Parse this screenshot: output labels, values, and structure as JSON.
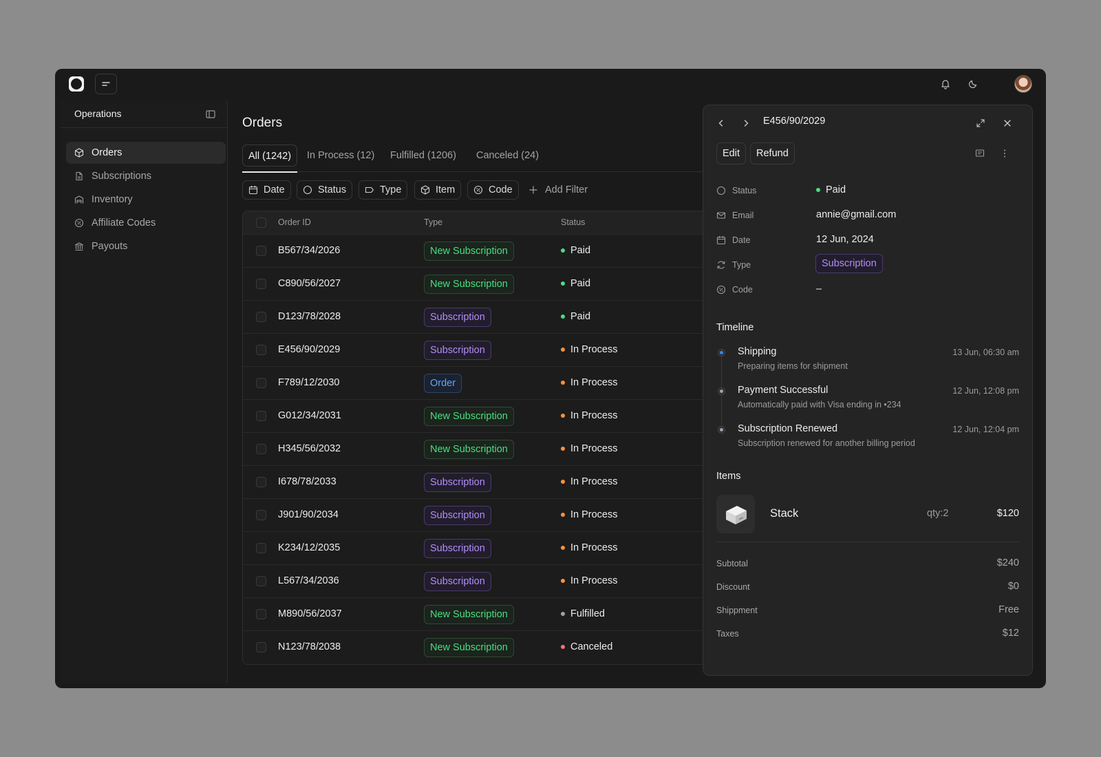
{
  "topbar": {
    "icons": [
      "logo-icon",
      "menu-icon",
      "bell-icon",
      "moon-icon",
      "avatar"
    ]
  },
  "sidebar": {
    "title": "Operations",
    "items": [
      {
        "label": "Orders",
        "icon": "box-icon",
        "active": true
      },
      {
        "label": "Subscriptions",
        "icon": "document-icon",
        "active": false
      },
      {
        "label": "Inventory",
        "icon": "warehouse-icon",
        "active": false
      },
      {
        "label": "Affiliate Codes",
        "icon": "badge-icon",
        "active": false
      },
      {
        "label": "Payouts",
        "icon": "bank-icon",
        "active": false
      }
    ]
  },
  "main": {
    "title": "Orders",
    "tabs": [
      {
        "label": "All (1242)",
        "active": true
      },
      {
        "label": "In Process (12)",
        "active": false
      },
      {
        "label": "Fulfilled (1206)",
        "active": false
      },
      {
        "label": "Canceled (24)",
        "active": false
      }
    ],
    "filters": [
      {
        "label": "Date",
        "icon": "calendar-icon"
      },
      {
        "label": "Status",
        "icon": "circle-icon"
      },
      {
        "label": "Type",
        "icon": "tag-icon"
      },
      {
        "label": "Item",
        "icon": "box-icon"
      },
      {
        "label": "Code",
        "icon": "badge-icon"
      }
    ],
    "add_filter": "Add Filter",
    "columns": [
      "Order ID",
      "Type",
      "Status"
    ],
    "rows": [
      {
        "id": "B567/34/2026",
        "type": "New Subscription",
        "status": "Paid"
      },
      {
        "id": "C890/56/2027",
        "type": "New Subscription",
        "status": "Paid"
      },
      {
        "id": "D123/78/2028",
        "type": "Subscription",
        "status": "Paid"
      },
      {
        "id": "E456/90/2029",
        "type": "Subscription",
        "status": "In Process"
      },
      {
        "id": "F789/12/2030",
        "type": "Order",
        "status": "In Process"
      },
      {
        "id": "G012/34/2031",
        "type": "New Subscription",
        "status": "In Process"
      },
      {
        "id": "H345/56/2032",
        "type": "New Subscription",
        "status": "In Process"
      },
      {
        "id": "I678/78/2033",
        "type": "Subscription",
        "status": "In Process"
      },
      {
        "id": "J901/90/2034",
        "type": "Subscription",
        "status": "In Process"
      },
      {
        "id": "K234/12/2035",
        "type": "Subscription",
        "status": "In Process"
      },
      {
        "id": "L567/34/2036",
        "type": "Subscription",
        "status": "In Process"
      },
      {
        "id": "M890/56/2037",
        "type": "New Subscription",
        "status": "Fulfilled"
      },
      {
        "id": "N123/78/2038",
        "type": "New Subscription",
        "status": "Canceled"
      }
    ]
  },
  "status_colors": {
    "Paid": "#4ade80",
    "In Process": "#fb923c",
    "Fulfilled": "#9ca3af",
    "Canceled": "#f87171"
  },
  "panel": {
    "title": "E456/90/2029",
    "edit_label": "Edit",
    "refund_label": "Refund",
    "props": [
      {
        "key": "Status",
        "value": "Paid",
        "icon": "circle-icon"
      },
      {
        "key": "Email",
        "value": "annie@gmail.com",
        "icon": "mail-icon"
      },
      {
        "key": "Date",
        "value": "12 Jun, 2024",
        "icon": "calendar-icon"
      },
      {
        "key": "Type",
        "value": "Subscription",
        "icon": "refresh-icon"
      },
      {
        "key": "Code",
        "value": "–",
        "icon": "badge-icon"
      }
    ],
    "timeline_title": "Timeline",
    "timeline": [
      {
        "title": "Shipping",
        "subtitle": "Preparing items for shipment",
        "time": "13 Jun, 06:30 am",
        "dot_color": "#3b82f6"
      },
      {
        "title": "Payment Successful",
        "subtitle": "Automatically paid with Visa ending in •234",
        "time": "12 Jun, 12:08 pm",
        "dot_color": "#9ca3af"
      },
      {
        "title": "Subscription Renewed",
        "subtitle": "Subscription renewed for another billing period",
        "time": "12 Jun, 12:04 pm",
        "dot_color": "#9ca3af"
      }
    ],
    "items_title": "Items",
    "item": {
      "name": "Stack",
      "qty": "qty:2",
      "price": "$120"
    },
    "summary": [
      {
        "key": "Subtotal",
        "value": "$240"
      },
      {
        "key": "Discount",
        "value": "$0"
      },
      {
        "key": "Shippment",
        "value": "Free"
      },
      {
        "key": "Taxes",
        "value": "$12"
      }
    ]
  }
}
